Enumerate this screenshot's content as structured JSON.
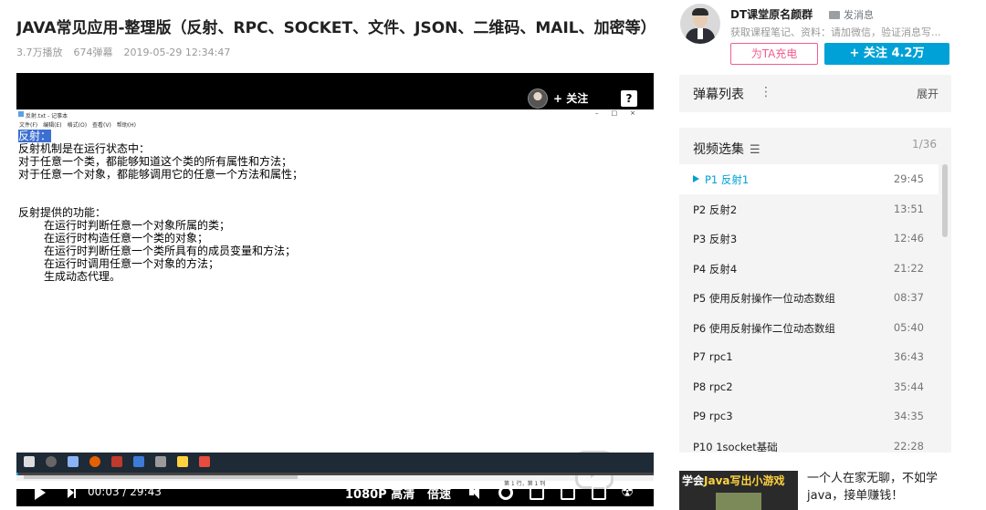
{
  "video": {
    "title": "JAVA常见应用-整理版（反射、RPC、SOCKET、文件、JSON、二维码、MAIL、加密等）",
    "plays": "3.7万播放",
    "danmaku_count": "674弹幕",
    "date": "2019-05-29 12:34:47"
  },
  "player": {
    "follow_label": "+ 关注",
    "help_label": "?",
    "time": "00:03 / 29:43",
    "progress": 0.0017,
    "quality": "1080P 高清",
    "speed": "倍速",
    "accent": "#00a1d6"
  },
  "notepad": {
    "title": "反射.txt - 记事本",
    "menu": [
      "文件(F)",
      "编辑(E)",
      "格式(O)",
      "查看(V)",
      "帮助(H)"
    ],
    "lines": [
      {
        "text": "反射：",
        "selected": true,
        "indent": false
      },
      {
        "text": "反射机制是在运行状态中：",
        "selected": false,
        "indent": false
      },
      {
        "text": "对于任意一个类，都能够知道这个类的所有属性和方法；",
        "selected": false,
        "indent": false
      },
      {
        "text": "对于任意一个对象，都能够调用它的任意一个方法和属性；",
        "selected": false,
        "indent": false
      },
      {
        "text": "",
        "selected": false,
        "indent": false
      },
      {
        "text": "",
        "selected": false,
        "indent": false
      },
      {
        "text": "反射提供的功能：",
        "selected": false,
        "indent": false
      },
      {
        "text": "在运行时判断任意一个对象所属的类；",
        "selected": false,
        "indent": true
      },
      {
        "text": "在运行时构造任意一个类的对象；",
        "selected": false,
        "indent": true
      },
      {
        "text": "在运行时判断任意一个类所具有的成员变量和方法；",
        "selected": false,
        "indent": true
      },
      {
        "text": "在运行时调用任意一个对象的方法；",
        "selected": false,
        "indent": true
      },
      {
        "text": "生成动态代理。",
        "selected": false,
        "indent": true
      }
    ],
    "status": "第 1 行，第 1 列"
  },
  "uploader": {
    "name": "DT课堂原名颜群",
    "message_label": "发消息",
    "description": "获取课程笔记、资料：请加微信，验证消息写...",
    "charge_label": "为TA充电",
    "follow_label": "+  关注 4.2万",
    "charge_color": "#f25d8e"
  },
  "danmaku_list": {
    "title": "弹幕列表",
    "more_icon": "⋮",
    "expand_label": "展开"
  },
  "episodes": {
    "title": "视频选集",
    "count": "1/36",
    "items": [
      {
        "label": "P1  反射1",
        "duration": "29:45",
        "active": true
      },
      {
        "label": "P2  反射2",
        "duration": "13:51",
        "active": false
      },
      {
        "label": "P3  反射3",
        "duration": "12:46",
        "active": false
      },
      {
        "label": "P4  反射4",
        "duration": "21:22",
        "active": false
      },
      {
        "label": "P5  使用反射操作一位动态数组",
        "duration": "08:37",
        "active": false
      },
      {
        "label": "P6  使用反射操作二位动态数组",
        "duration": "05:40",
        "active": false
      },
      {
        "label": "P7  rpc1",
        "duration": "36:43",
        "active": false
      },
      {
        "label": "P8  rpc2",
        "duration": "35:44",
        "active": false
      },
      {
        "label": "P9  rpc3",
        "duration": "34:35",
        "active": false
      },
      {
        "label": "P10  1socket基础",
        "duration": "22:28",
        "active": false
      }
    ]
  },
  "ad": {
    "thumb_prefix": "学会",
    "thumb_highlight": "Java写出小游戏",
    "text": "一个人在家无聊，不如学java，接单赚钱！"
  }
}
